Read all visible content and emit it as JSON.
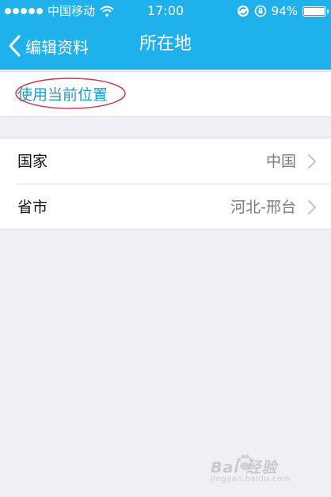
{
  "status_bar": {
    "carrier": "中国移动",
    "time": "17:00",
    "battery_text": "94%",
    "battery_level": 0.94
  },
  "nav": {
    "back_label": "编辑资料",
    "title": "所在地"
  },
  "location": {
    "use_current_label": "使用当前位置"
  },
  "rows": [
    {
      "label": "国家",
      "value": "中国"
    },
    {
      "label": "省市",
      "value": "河北-邢台"
    }
  ],
  "watermark": {
    "text": "Bai 经验",
    "url": "jingyan.baidu.com"
  },
  "colors": {
    "accent": "#1eb1ec",
    "link": "#1f9cc7",
    "highlight": "#d0354a"
  }
}
